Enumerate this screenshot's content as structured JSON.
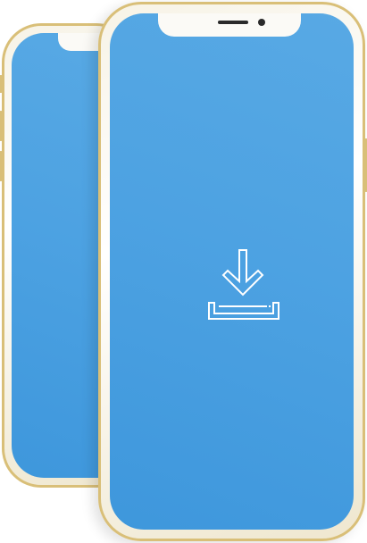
{
  "colors": {
    "screen": "#4da2e2",
    "frame_gold": "#d9bf78",
    "body": "#fbfaf6",
    "icon_stroke": "#ffffff"
  },
  "icons": {
    "main": "download-icon"
  }
}
